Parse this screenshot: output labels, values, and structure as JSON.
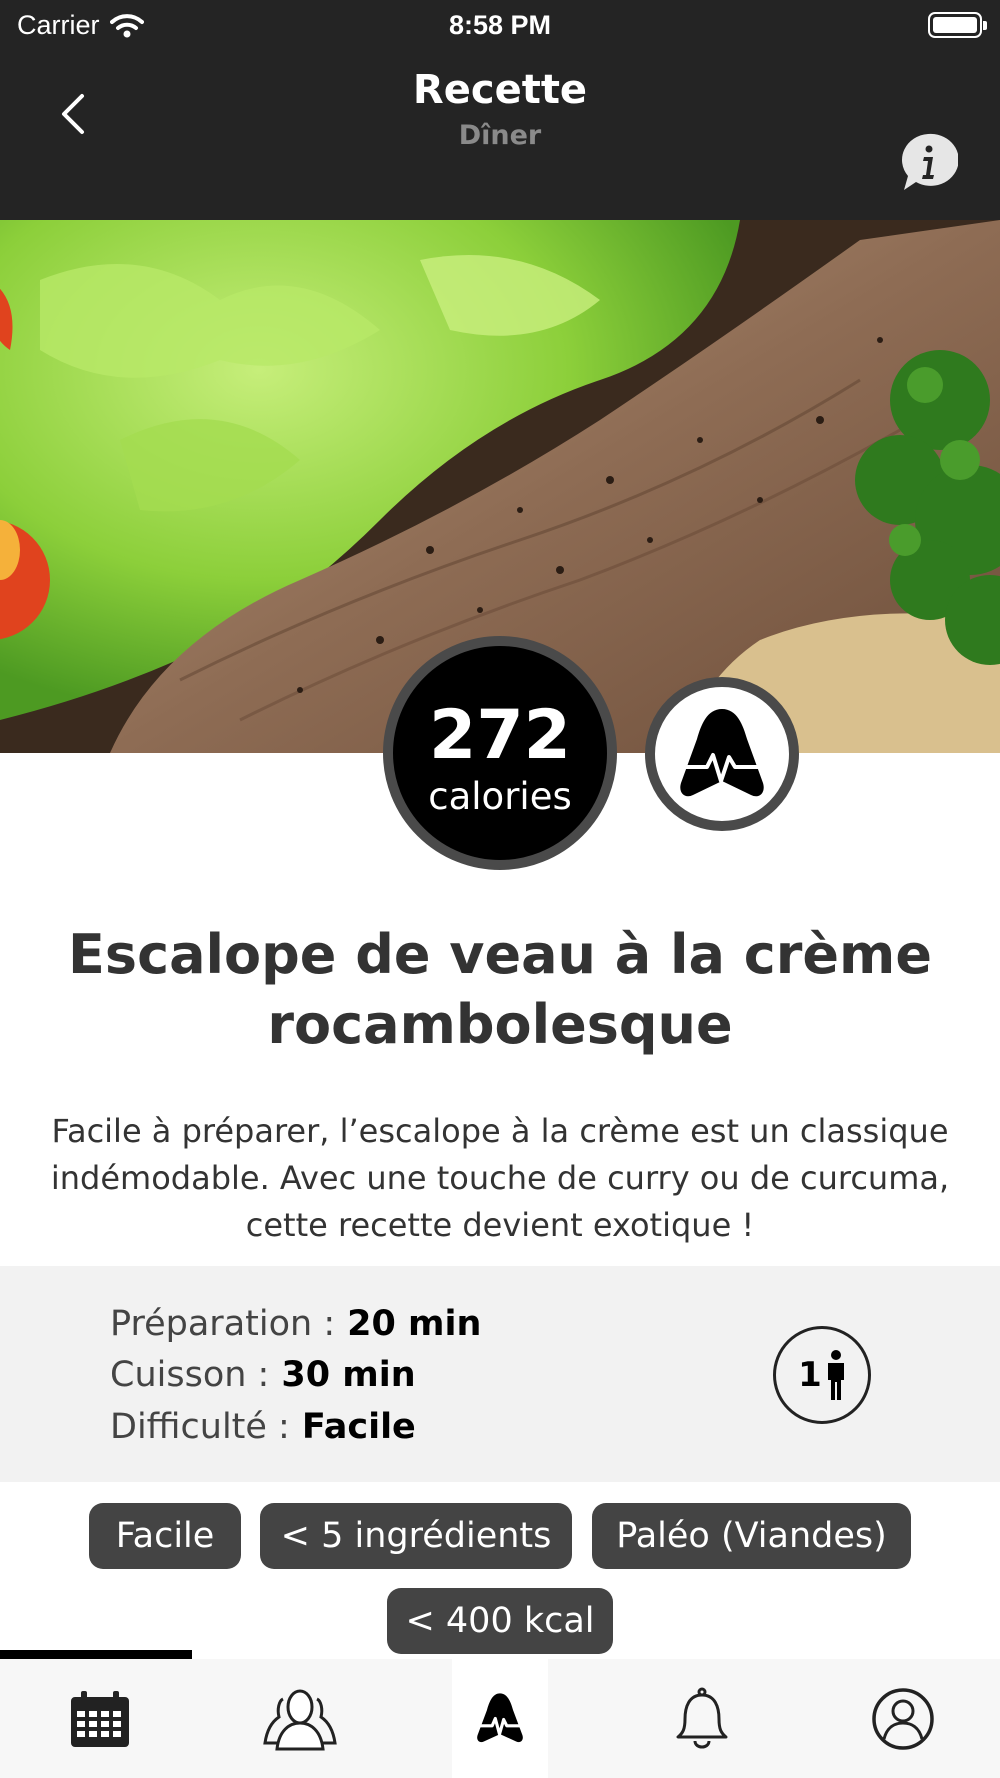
{
  "status_bar": {
    "carrier": "Carrier",
    "time": "8:58 PM"
  },
  "nav": {
    "title": "Recette",
    "subtitle": "Dîner"
  },
  "recipe": {
    "calories_value": "272",
    "calories_label": "calories",
    "title": "Escalope de veau à la crème rocambolesque",
    "description": "Facile à préparer, l’escalope à la crème est un classique indémodable. Avec une touche de curry ou de curcuma, cette recette devient exotique !",
    "details": {
      "preparation_label": "Préparation :",
      "preparation_value": "20 min",
      "cooking_label": "Cuisson :",
      "cooking_value": "30 min",
      "difficulty_label": "Difficulté :",
      "difficulty_value": "Facile"
    },
    "servings": "1",
    "tags": [
      "Facile",
      "< 5 ingrédients",
      "Paléo (Viandes)",
      "< 400 kcal"
    ]
  },
  "tab_bar": {
    "items": [
      {
        "icon": "calendar-icon"
      },
      {
        "icon": "community-icon"
      },
      {
        "icon": "brand-logo-icon"
      },
      {
        "icon": "bell-icon"
      },
      {
        "icon": "profile-icon"
      }
    ],
    "active_index": 2
  },
  "colors": {
    "bar_bg": "#242424",
    "tag_bg": "#444444",
    "panel_bg": "#f2f2f2"
  }
}
